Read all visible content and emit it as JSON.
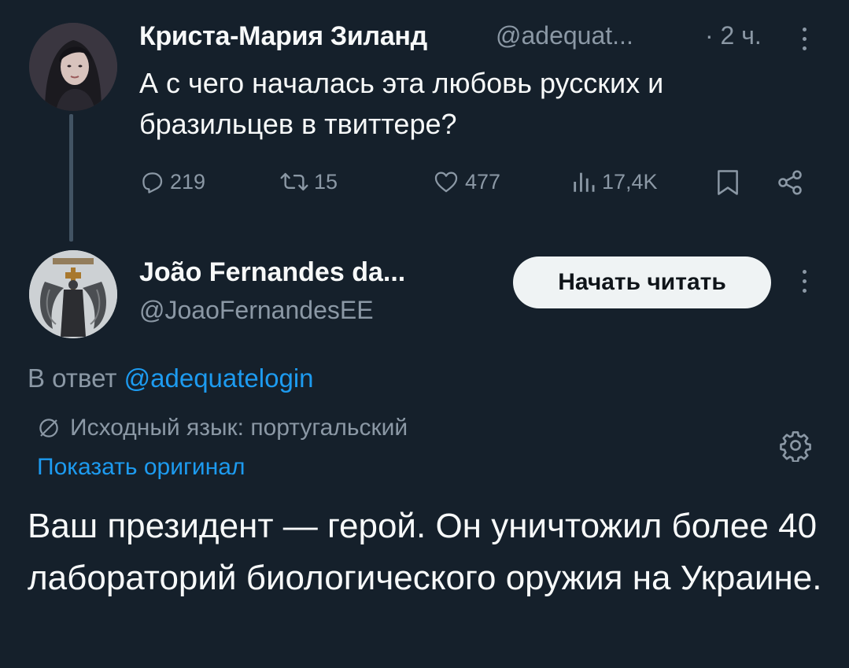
{
  "parent_tweet": {
    "author_name": "Криста-Мария Зиланд",
    "handle": "@adequat...",
    "time": "· 2 ч.",
    "text": "А с чего началась эта любовь русских и бразильцев в твиттере?",
    "replies": "219",
    "retweets": "15",
    "likes": "477",
    "views": "17,4K"
  },
  "reply_tweet": {
    "author_name": "João Fernandes da...",
    "handle": "@JoaoFernandesEE",
    "follow_label": "Начать читать",
    "reply_to_prefix": "В ответ",
    "reply_to_mention": "@adequatelogin",
    "translated_label": "Исходный язык: португальский",
    "show_original": "Показать оригинал",
    "text": "Ваш президент — герой. Он уничтожил более 40 лабораторий биологического оружия на Украине."
  },
  "icons": {
    "reply": "reply-icon",
    "retweet": "retweet-icon",
    "like": "heart-icon",
    "views": "views-icon",
    "bookmark": "bookmark-icon",
    "share": "share-icon",
    "more": "more-icon",
    "translate": "translate-icon",
    "settings": "gear-icon"
  },
  "colors": {
    "background": "#15202b",
    "text_primary": "#f7f9f9",
    "text_secondary": "#8b98a5",
    "accent": "#1d9bf0",
    "button_bg": "#eff3f4"
  }
}
